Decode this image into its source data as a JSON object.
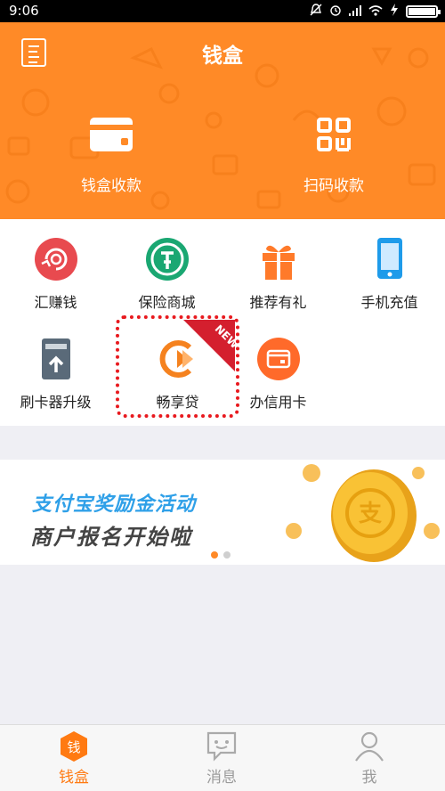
{
  "status_bar": {
    "time": "9:06"
  },
  "header": {
    "title": "钱盒",
    "actions": [
      {
        "label": "钱盒收款",
        "icon": "card-icon"
      },
      {
        "label": "扫码收款",
        "icon": "qr-code-icon"
      }
    ]
  },
  "services": [
    {
      "label": "汇赚钱",
      "icon": "earn-money-icon",
      "color": "#e84a4f"
    },
    {
      "label": "保险商城",
      "icon": "insurance-shield-icon",
      "color": "#1aa772"
    },
    {
      "label": "推荐有礼",
      "icon": "gift-icon",
      "color": "#ff7a2a"
    },
    {
      "label": "手机充值",
      "icon": "mobile-phone-icon",
      "color": "#1e9bea"
    },
    {
      "label": "刷卡器升级",
      "icon": "card-reader-upgrade-icon",
      "color": "#5a6a79"
    },
    {
      "label": "畅享贷",
      "icon": "loan-icon",
      "color": "#f5821f",
      "badge": "NEW"
    },
    {
      "label": "办信用卡",
      "icon": "credit-card-icon",
      "color": "#ff6a2a"
    }
  ],
  "banner": {
    "line1": "支付宝奖励金活动",
    "line2": "商户报名开始啦",
    "coin_char": "支"
  },
  "tabs": [
    {
      "label": "钱盒",
      "icon": "wallet-icon",
      "active": true,
      "glyph": "钱"
    },
    {
      "label": "消息",
      "icon": "message-icon",
      "active": false
    },
    {
      "label": "我",
      "icon": "profile-icon",
      "active": false
    }
  ],
  "colors": {
    "brand": "#ff8a27",
    "highlight": "#e8191e"
  }
}
